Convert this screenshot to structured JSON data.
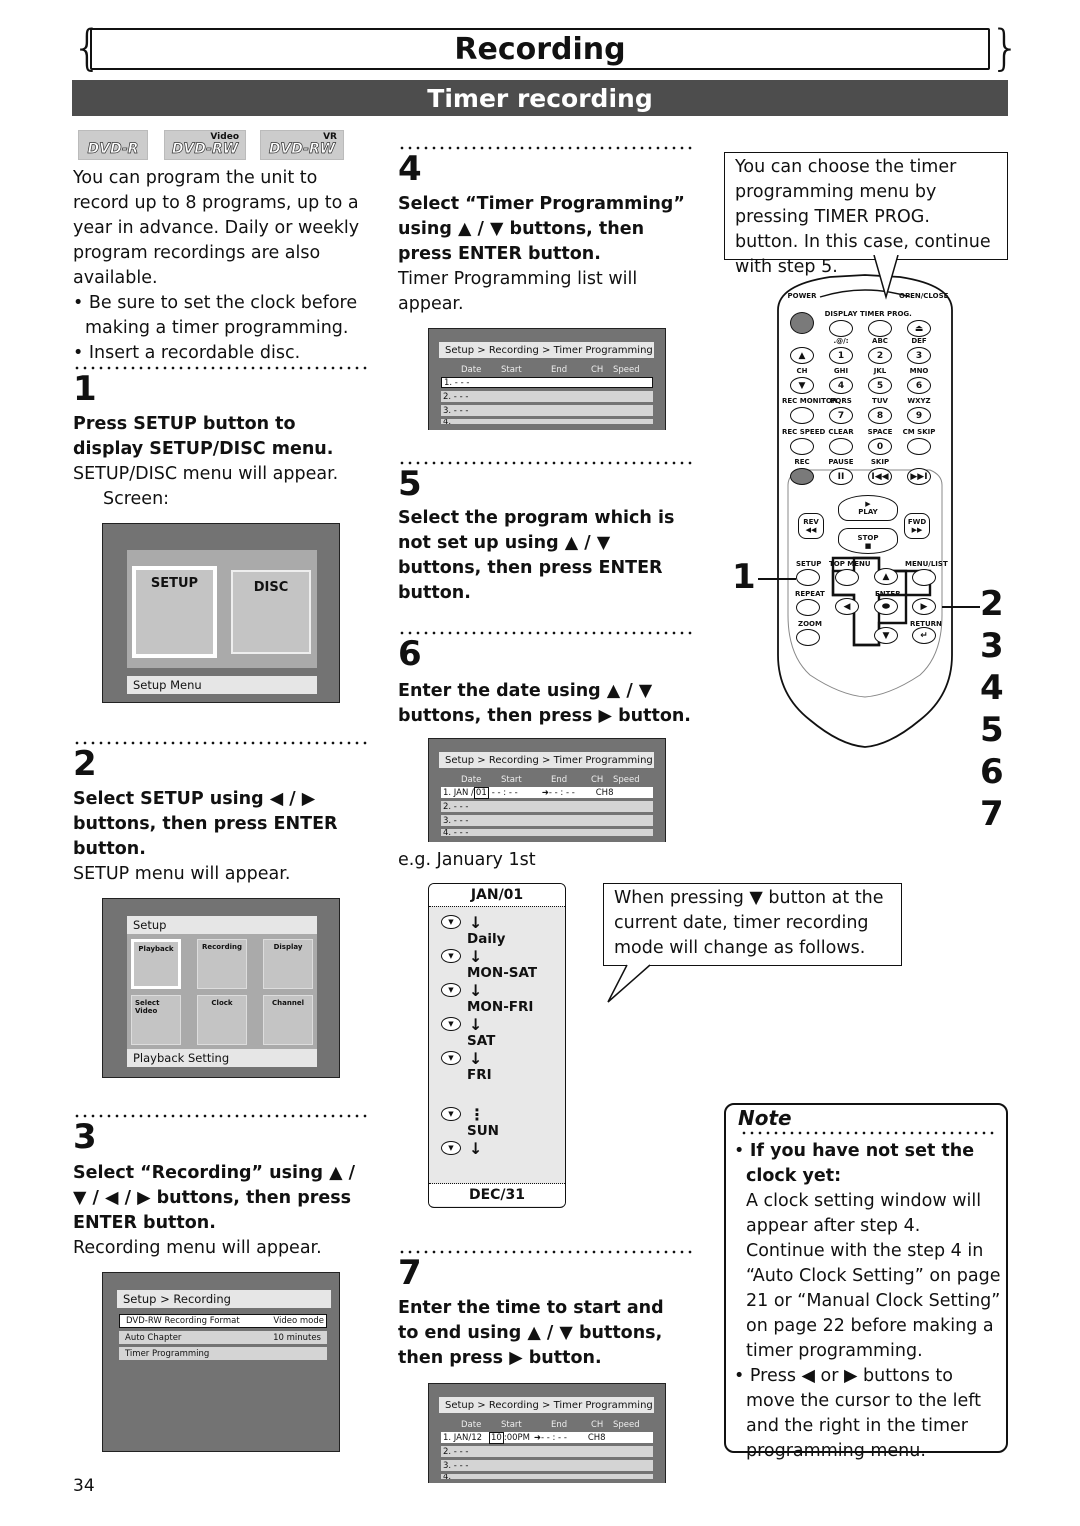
{
  "header": {
    "title": "Recording",
    "section": "Timer recording"
  },
  "badges": [
    {
      "label": "DVD-R",
      "sup": ""
    },
    {
      "label": "DVD-RW",
      "sup": "Video"
    },
    {
      "label": "DVD-RW",
      "sup": "VR"
    }
  ],
  "intro": {
    "paragraph": "You can program the unit to record up to 8 programs, up to a year in advance. Daily or weekly program recordings are also available.",
    "bullets": [
      "Be sure to set the clock before making a timer programming.",
      "Insert a recordable disc."
    ]
  },
  "steps": [
    {
      "num": "1",
      "instruction": "Press SETUP button to display SETUP/DISC menu.",
      "result": "SETUP/DISC menu will appear.",
      "extra": "Screen:"
    },
    {
      "num": "2",
      "instruction": "Select SETUP using ◀ / ▶ buttons, then press ENTER button.",
      "result": "SETUP menu will appear."
    },
    {
      "num": "3",
      "instruction": "Select “Recording” using ▲ / ▼ / ◀ / ▶ buttons, then press ENTER button.",
      "result": "Recording menu will appear."
    },
    {
      "num": "4",
      "instruction": "Select “Timer Programming” using ▲ / ▼ buttons, then press ENTER button.",
      "result": "Timer Programming list will appear."
    },
    {
      "num": "5",
      "instruction": "Select the program which is not set up using ▲ / ▼ buttons, then press ENTER button."
    },
    {
      "num": "6",
      "instruction": "Enter the date using ▲ / ▼ buttons, then press ▶ button.",
      "example": "e.g. January 1st"
    },
    {
      "num": "7",
      "instruction": "Enter the time to start and to end using ▲ / ▼ buttons, then press ▶ button."
    }
  ],
  "screens": {
    "setup_disc": {
      "tiles": [
        "SETUP",
        "DISC"
      ],
      "footer": "Setup Menu"
    },
    "setup": {
      "title": "Setup",
      "tiles": [
        "Playback",
        "Recording",
        "Display",
        "Select Video",
        "Clock",
        "Channel"
      ],
      "footer": "Playback Setting"
    },
    "recording": {
      "title": "Setup > Recording",
      "rows": [
        {
          "label": "DVD-RW Recording Format",
          "value": "Video mode"
        },
        {
          "label": "Auto Chapter",
          "value": "10 minutes"
        },
        {
          "label": "Timer Programming",
          "value": ""
        }
      ]
    },
    "timer_columns": [
      "Date",
      "Start",
      "End",
      "CH",
      "Speed"
    ],
    "timer_title": "Setup > Recording > Timer Programming",
    "timer_step4": {
      "rows": [
        "1. - - -",
        "2. - - -",
        "3. - - -",
        "4."
      ]
    },
    "timer_step6": {
      "row1": {
        "date": "1. JAN /",
        "cursor": "01",
        "start": "- - : - -",
        "end": "➜- - : - -",
        "ch": "CH8"
      },
      "rows": [
        "2. - - -",
        "3. - - -",
        "4. - - -"
      ]
    },
    "timer_step7": {
      "row1": {
        "date": "1. JAN/12",
        "cursor": "10",
        "start": ":00PM",
        "end": "➜- - : - -",
        "ch": "CH8"
      },
      "rows": [
        "2. - - -",
        "3. - - -",
        "4."
      ]
    }
  },
  "date_flow": {
    "top": "JAN/01",
    "modes": [
      "Daily",
      "MON-SAT",
      "MON-FRI",
      "SAT",
      "FRI",
      "SUN"
    ],
    "bottom": "DEC/31"
  },
  "callouts": {
    "timer_prog": "You can choose the timer programming menu by pressing TIMER PROG. button. In this case, continue with step 5.",
    "down_press": "When pressing ▼ button at the current date, timer recording mode will change as follows."
  },
  "remote": {
    "row1": [
      "POWER",
      "DISPLAY",
      "TIMER PROG.",
      "OPEN/CLOSE"
    ],
    "row2_labels": [
      "",
      ".@/:",
      "ABC",
      "DEF"
    ],
    "row2_keys": [
      "▲",
      "1",
      "2",
      "3"
    ],
    "row3_labels": [
      "CH",
      "GHI",
      "JKL",
      "MNO"
    ],
    "row3_keys": [
      "▼",
      "4",
      "5",
      "6"
    ],
    "row4_labels": [
      "REC MONITOR",
      "PQRS",
      "TUV",
      "WXYZ"
    ],
    "row4_keys": [
      "",
      "7",
      "8",
      "9"
    ],
    "row5_labels": [
      "REC SPEED",
      "CLEAR",
      "SPACE",
      "CM SKIP"
    ],
    "row5_keys": [
      "",
      "",
      "0",
      ""
    ],
    "row6_labels": [
      "REC",
      "PAUSE",
      "SKIP",
      ""
    ],
    "row6_keys": [
      "",
      "II",
      "I◀◀",
      "▶▶I"
    ],
    "transport": {
      "play": "PLAY",
      "stop": "STOP",
      "rev": "REV",
      "fwd": "FWD"
    },
    "nav": {
      "setup": "SETUP",
      "top_menu": "TOP MENU",
      "menu_list": "MENU/LIST",
      "repeat": "REPEAT",
      "enter": "ENTER",
      "zoom": "ZOOM",
      "return": "RETURN"
    },
    "step_markers": {
      "left": "1",
      "right": [
        "2",
        "3",
        "4",
        "5",
        "6",
        "7"
      ]
    }
  },
  "note": {
    "title": "Note",
    "b1_head": "If you have not set the clock yet:",
    "b1_body": "A clock setting window will appear after step 4.  Continue with the step 4 in “Auto Clock Setting” on page 21 or “Manual Clock Setting” on page 22 before making a timer programming.",
    "b2": "Press ◀ or ▶ buttons to move the cursor to the left and the right in the timer programming menu."
  },
  "page_number": "34"
}
